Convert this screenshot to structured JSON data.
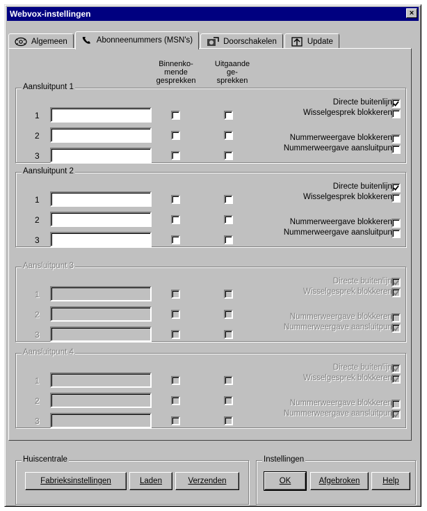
{
  "window": {
    "title": "Webvox-instellingen",
    "close_label": "×"
  },
  "tabs": [
    {
      "label": "Algemeen",
      "icon": "gear-icon"
    },
    {
      "label": "Abonneenummers (MSN's)",
      "icon": "telephone-icon"
    },
    {
      "label": "Doorschakelen",
      "icon": "forward-icon"
    },
    {
      "label": "Update",
      "icon": "update-icon"
    }
  ],
  "active_tab": 1,
  "columns": {
    "incoming": "Binnenko-\nmende\ngesprekken",
    "outgoing": "Uitgaande\nge-\nsprekken"
  },
  "row_numbers": [
    "1",
    "2",
    "3"
  ],
  "options": {
    "direct_line": "Directe buitenlijn:",
    "block_call_waiting": "Wisselgesprek blokkeren:",
    "block_number_display": "Nummerweergave blokkeren:",
    "number_display_port": "Nummerweergave aansluitpunt"
  },
  "ports": [
    {
      "label": "Aansluitpunt 1",
      "enabled": true,
      "msn": [
        "",
        "",
        ""
      ],
      "incoming": [
        false,
        false,
        false
      ],
      "outgoing": [
        false,
        false,
        false
      ],
      "direct_line": true,
      "block_call_waiting": false,
      "block_number_display": false,
      "number_display_port": false
    },
    {
      "label": "Aansluitpunt 2",
      "enabled": true,
      "msn": [
        "",
        "",
        ""
      ],
      "incoming": [
        false,
        false,
        false
      ],
      "outgoing": [
        false,
        false,
        false
      ],
      "direct_line": true,
      "block_call_waiting": false,
      "block_number_display": false,
      "number_display_port": false
    },
    {
      "label": "Aansluitpunt 3",
      "enabled": false,
      "msn": [
        "",
        "",
        ""
      ],
      "incoming": [
        false,
        false,
        false
      ],
      "outgoing": [
        false,
        false,
        false
      ],
      "direct_line": true,
      "block_call_waiting": true,
      "block_number_display": false,
      "number_display_port": true
    },
    {
      "label": "Aansluitpunt 4",
      "enabled": false,
      "msn": [
        "",
        "",
        ""
      ],
      "incoming": [
        false,
        false,
        false
      ],
      "outgoing": [
        false,
        false,
        false
      ],
      "direct_line": true,
      "block_call_waiting": true,
      "block_number_display": false,
      "number_display_port": true
    }
  ],
  "huiscentrale": {
    "label": "Huiscentrale",
    "factory_settings": "Fabrieksinstellingen",
    "load": "Laden",
    "send": "Verzenden"
  },
  "instellingen": {
    "label": "Instellingen",
    "ok": "OK",
    "cancel": "Afgebroken",
    "help": "Help"
  }
}
